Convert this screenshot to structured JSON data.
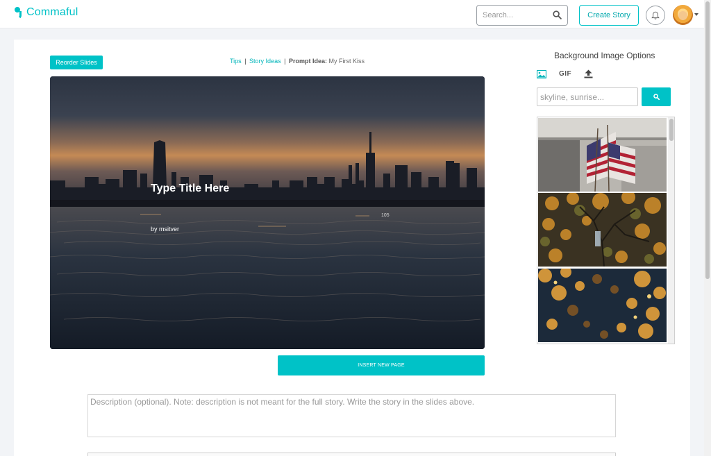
{
  "header": {
    "logo_text": "Commaful",
    "search_placeholder": "Search...",
    "create_story_label": "Create Story",
    "icons": {
      "search": "search-icon",
      "bell": "bell-icon",
      "avatar": "avatar"
    }
  },
  "editor": {
    "reorder_label": "Reorder Slides",
    "tips": {
      "tips_link": "Tips",
      "story_ideas_link": "Story Ideas",
      "separator": "|",
      "prompt_label": "Prompt Idea:",
      "prompt_value": "My First Kiss"
    },
    "slide": {
      "title": "Type Title Here",
      "author": "by msitver",
      "char_count": "105"
    },
    "insert_label": "INSERT NEW PAGE",
    "description_placeholder": "Description (optional). Note: description is not meant for the full story. Write the story in the slides above."
  },
  "background_panel": {
    "title": "Background Image Options",
    "tabs": {
      "image": "image-icon",
      "gif": "GIF",
      "upload": "upload-icon"
    },
    "search_placeholder": "skyline, sunrise...",
    "images": [
      "flags-image",
      "autumn-tree-image",
      "autumn-leaves-image"
    ]
  },
  "colors": {
    "accent": "#00c2c7",
    "page_bg": "#f2f4f7"
  }
}
